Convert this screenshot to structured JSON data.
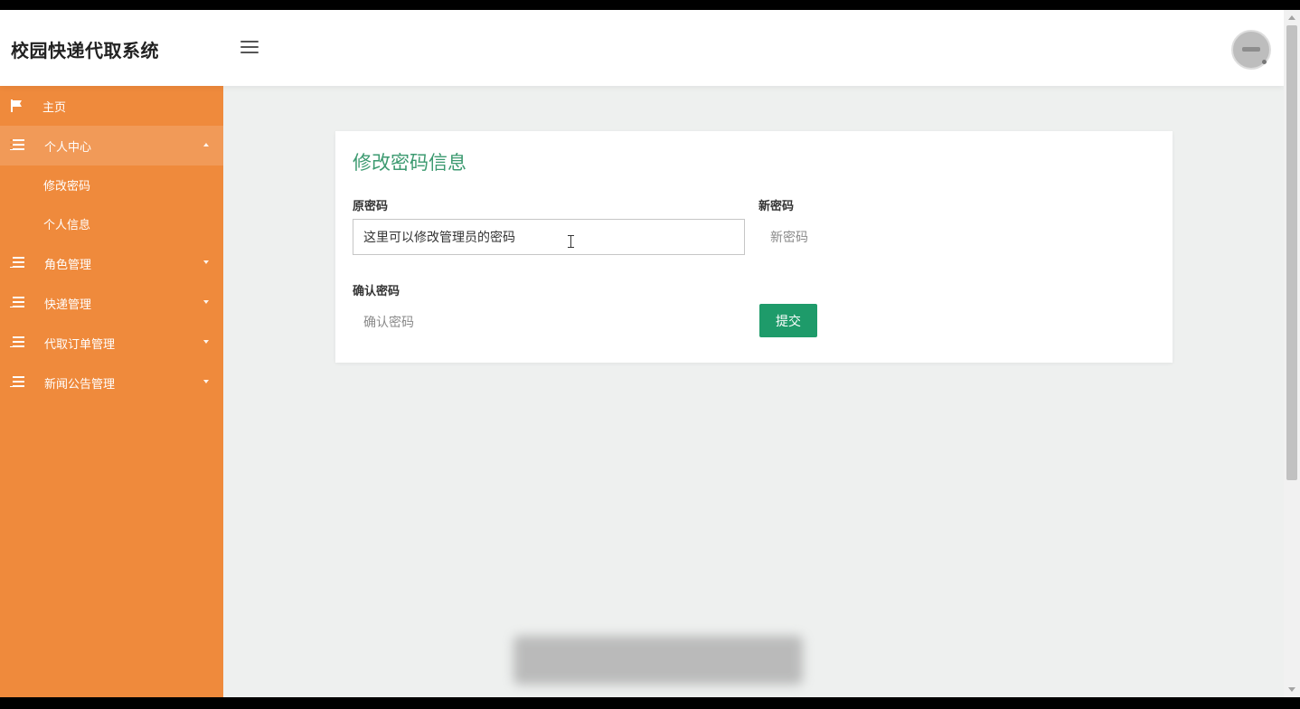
{
  "app": {
    "title": "校园快递代取系统"
  },
  "sidebar": {
    "items": [
      {
        "label": "主页"
      },
      {
        "label": "个人中心",
        "children": [
          {
            "label": "修改密码"
          },
          {
            "label": "个人信息"
          }
        ]
      },
      {
        "label": "角色管理"
      },
      {
        "label": "快递管理"
      },
      {
        "label": "代取订单管理"
      },
      {
        "label": "新闻公告管理"
      }
    ]
  },
  "form": {
    "title": "修改密码信息",
    "old_password": {
      "label": "原密码",
      "value": "这里可以修改管理员的密码"
    },
    "new_password": {
      "label": "新密码",
      "placeholder": "新密码"
    },
    "confirm_password": {
      "label": "确认密码",
      "placeholder": "确认密码"
    },
    "submit_label": "提交"
  },
  "colors": {
    "sidebar": "#ef8a3c",
    "accent": "#1e9b6a",
    "title": "#3c9a70"
  }
}
